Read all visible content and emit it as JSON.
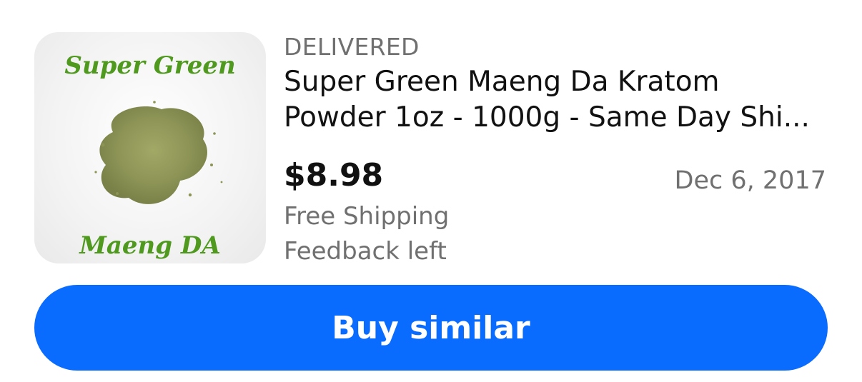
{
  "order": {
    "status": "DELIVERED",
    "title_line1": "Super Green Maeng Da Kratom",
    "title_line2": "Powder 1oz - 1000g  - Same Day Shi...",
    "price": "$8.98",
    "date": "Dec 6, 2017",
    "shipping": "Free Shipping",
    "feedback": "Feedback left",
    "image": {
      "top_text": "Super Green",
      "bottom_text": "Maeng DA",
      "text_color": "#4f9a1e",
      "powder_color": "#8d9456"
    }
  },
  "actions": {
    "buy_similar_label": "Buy similar",
    "button_color": "#0a6cff"
  }
}
